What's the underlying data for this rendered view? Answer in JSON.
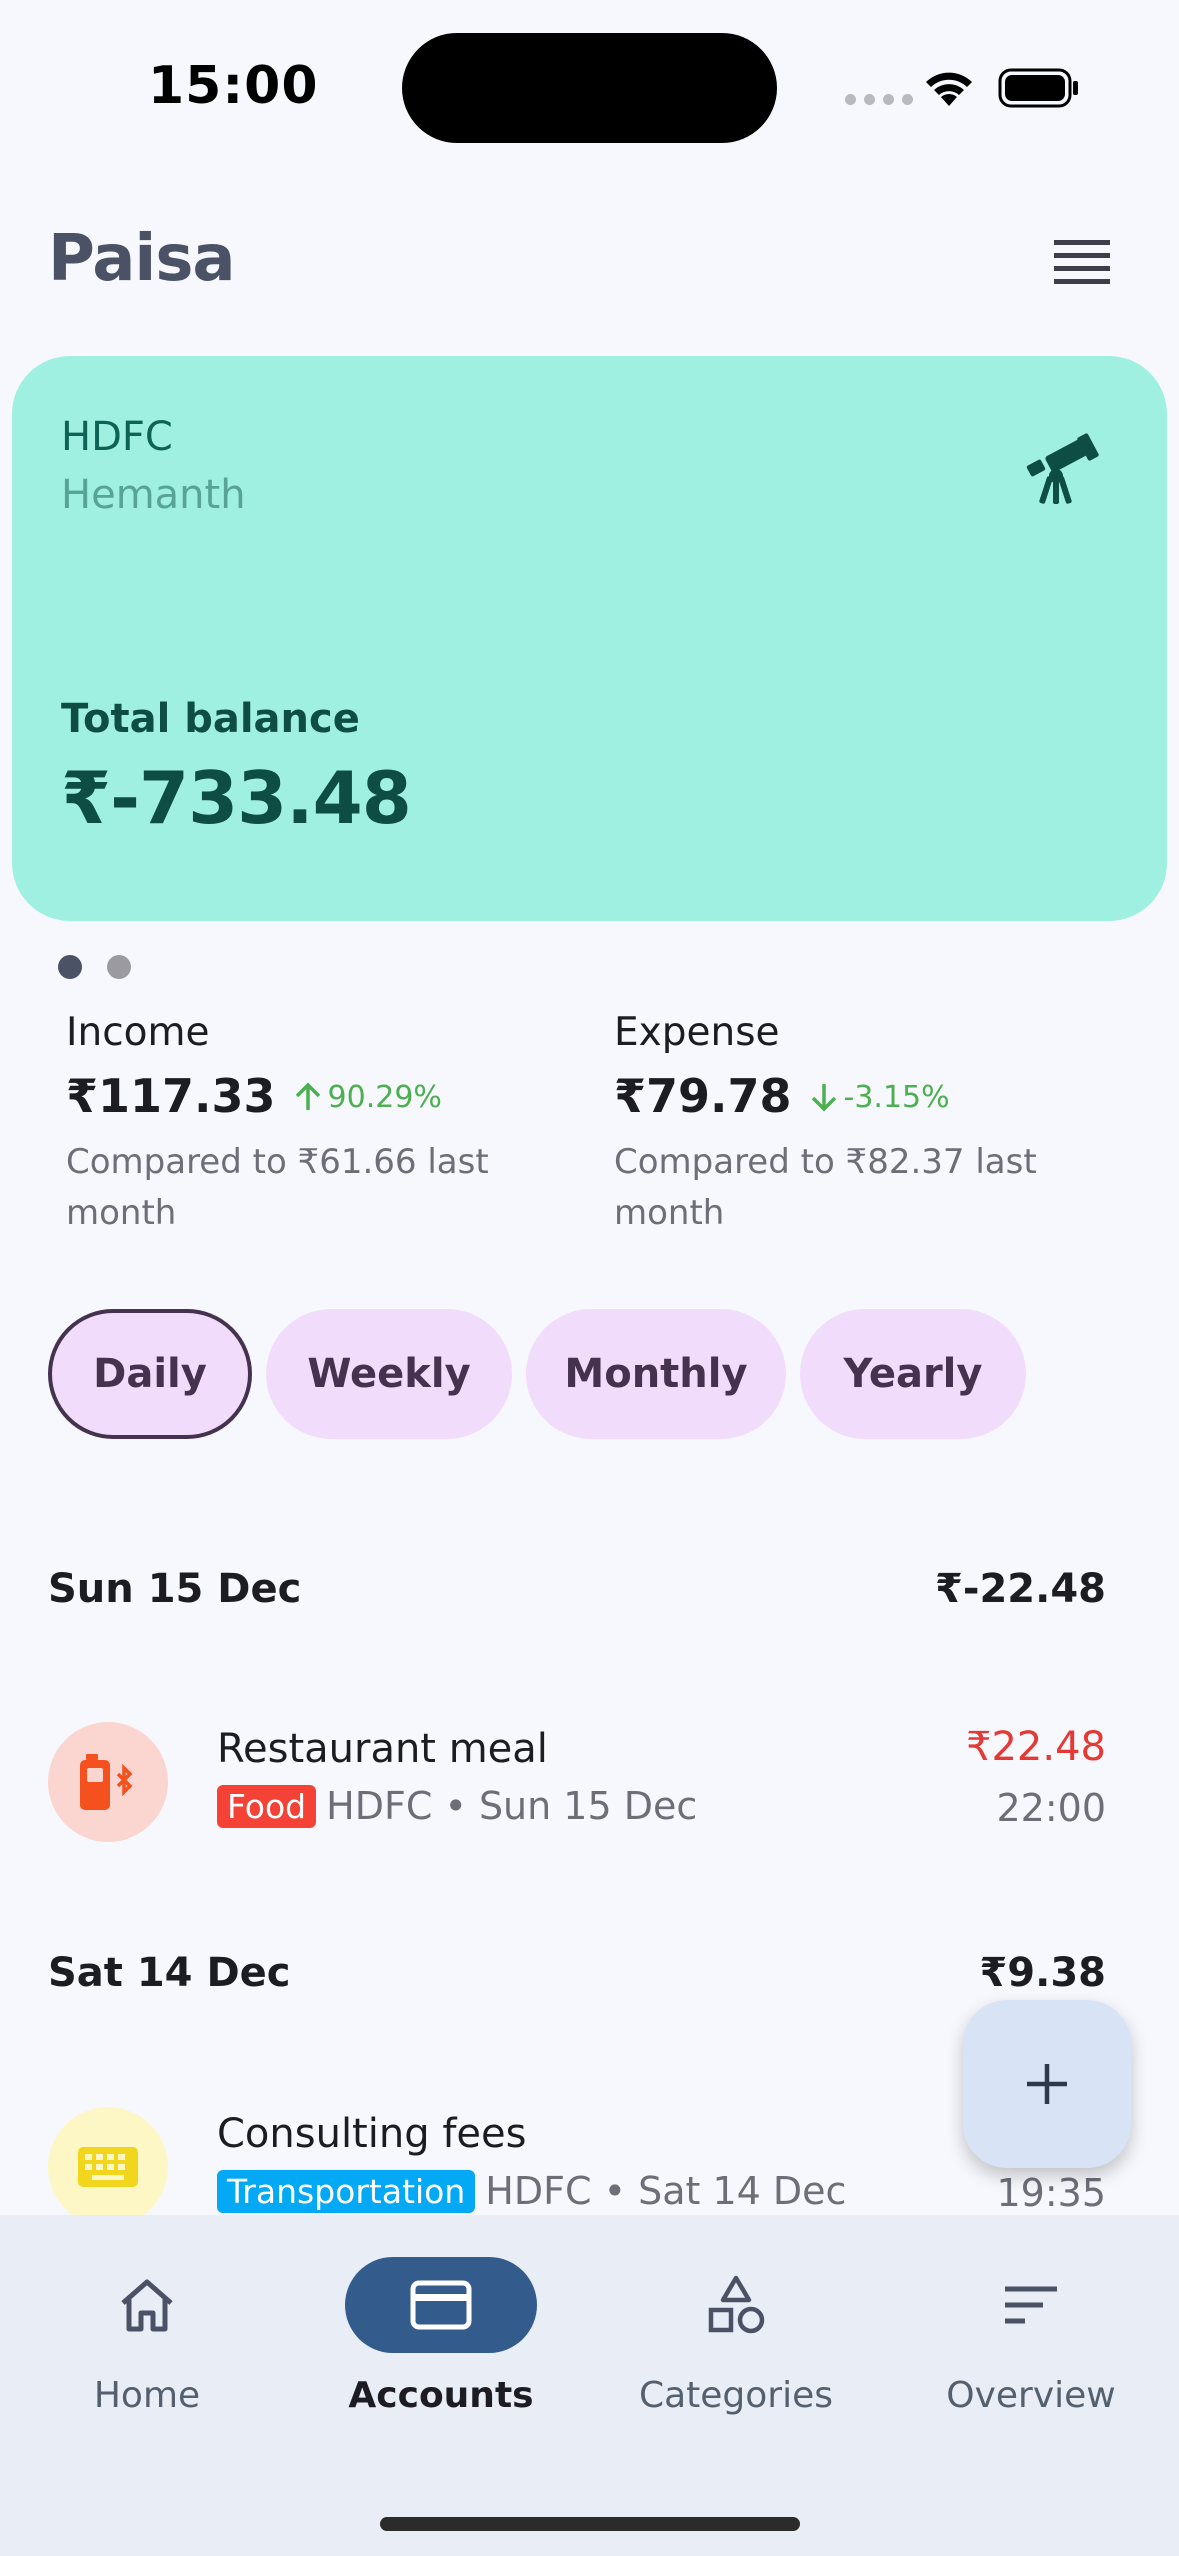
{
  "status_bar": {
    "time": "15:00"
  },
  "app": {
    "title": "Paisa"
  },
  "account_card": {
    "bank": "HDFC",
    "holder": "Hemanth",
    "balance_label": "Total balance",
    "balance": "₹-733.48",
    "icon": "telescope-icon",
    "color": "#a0f0e1"
  },
  "pager": {
    "total": 2,
    "active_index": 0
  },
  "summary": {
    "income": {
      "label": "Income",
      "amount": "₹117.33",
      "change": "90.29%",
      "compare": "Compared to ₹61.66 last month"
    },
    "expense": {
      "label": "Expense",
      "amount": "₹79.78",
      "change": "-3.15%",
      "compare": "Compared to ₹82.37 last month"
    }
  },
  "filters": [
    {
      "label": "Daily",
      "selected": true
    },
    {
      "label": "Weekly",
      "selected": false
    },
    {
      "label": "Monthly",
      "selected": false
    },
    {
      "label": "Yearly",
      "selected": false
    }
  ],
  "days": [
    {
      "date": "Sun 15 Dec",
      "total": "₹-22.48",
      "transactions": [
        {
          "title": "Restaurant meal",
          "category": "Food",
          "category_color": "#f44336",
          "details": "HDFC • Sun 15 Dec",
          "amount": "₹22.48",
          "amount_color": "#e53935",
          "time": "22:00",
          "icon": "battery-bluetooth-icon"
        }
      ]
    },
    {
      "date": "Sat 14 Dec",
      "total": "₹9.38",
      "transactions": [
        {
          "title": "Consulting fees",
          "category": "Transportation",
          "category_color": "#03a9f4",
          "details": "HDFC • Sat 14 Dec",
          "time": "19:35",
          "icon": "keyboard-icon"
        }
      ]
    }
  ],
  "fab": {
    "icon": "plus-icon"
  },
  "bottom_nav": [
    {
      "label": "Home",
      "icon": "home-icon",
      "active": false
    },
    {
      "label": "Accounts",
      "icon": "credit-card-icon",
      "active": true
    },
    {
      "label": "Categories",
      "icon": "shapes-icon",
      "active": false
    },
    {
      "label": "Overview",
      "icon": "sort-lines-icon",
      "active": false
    }
  ]
}
